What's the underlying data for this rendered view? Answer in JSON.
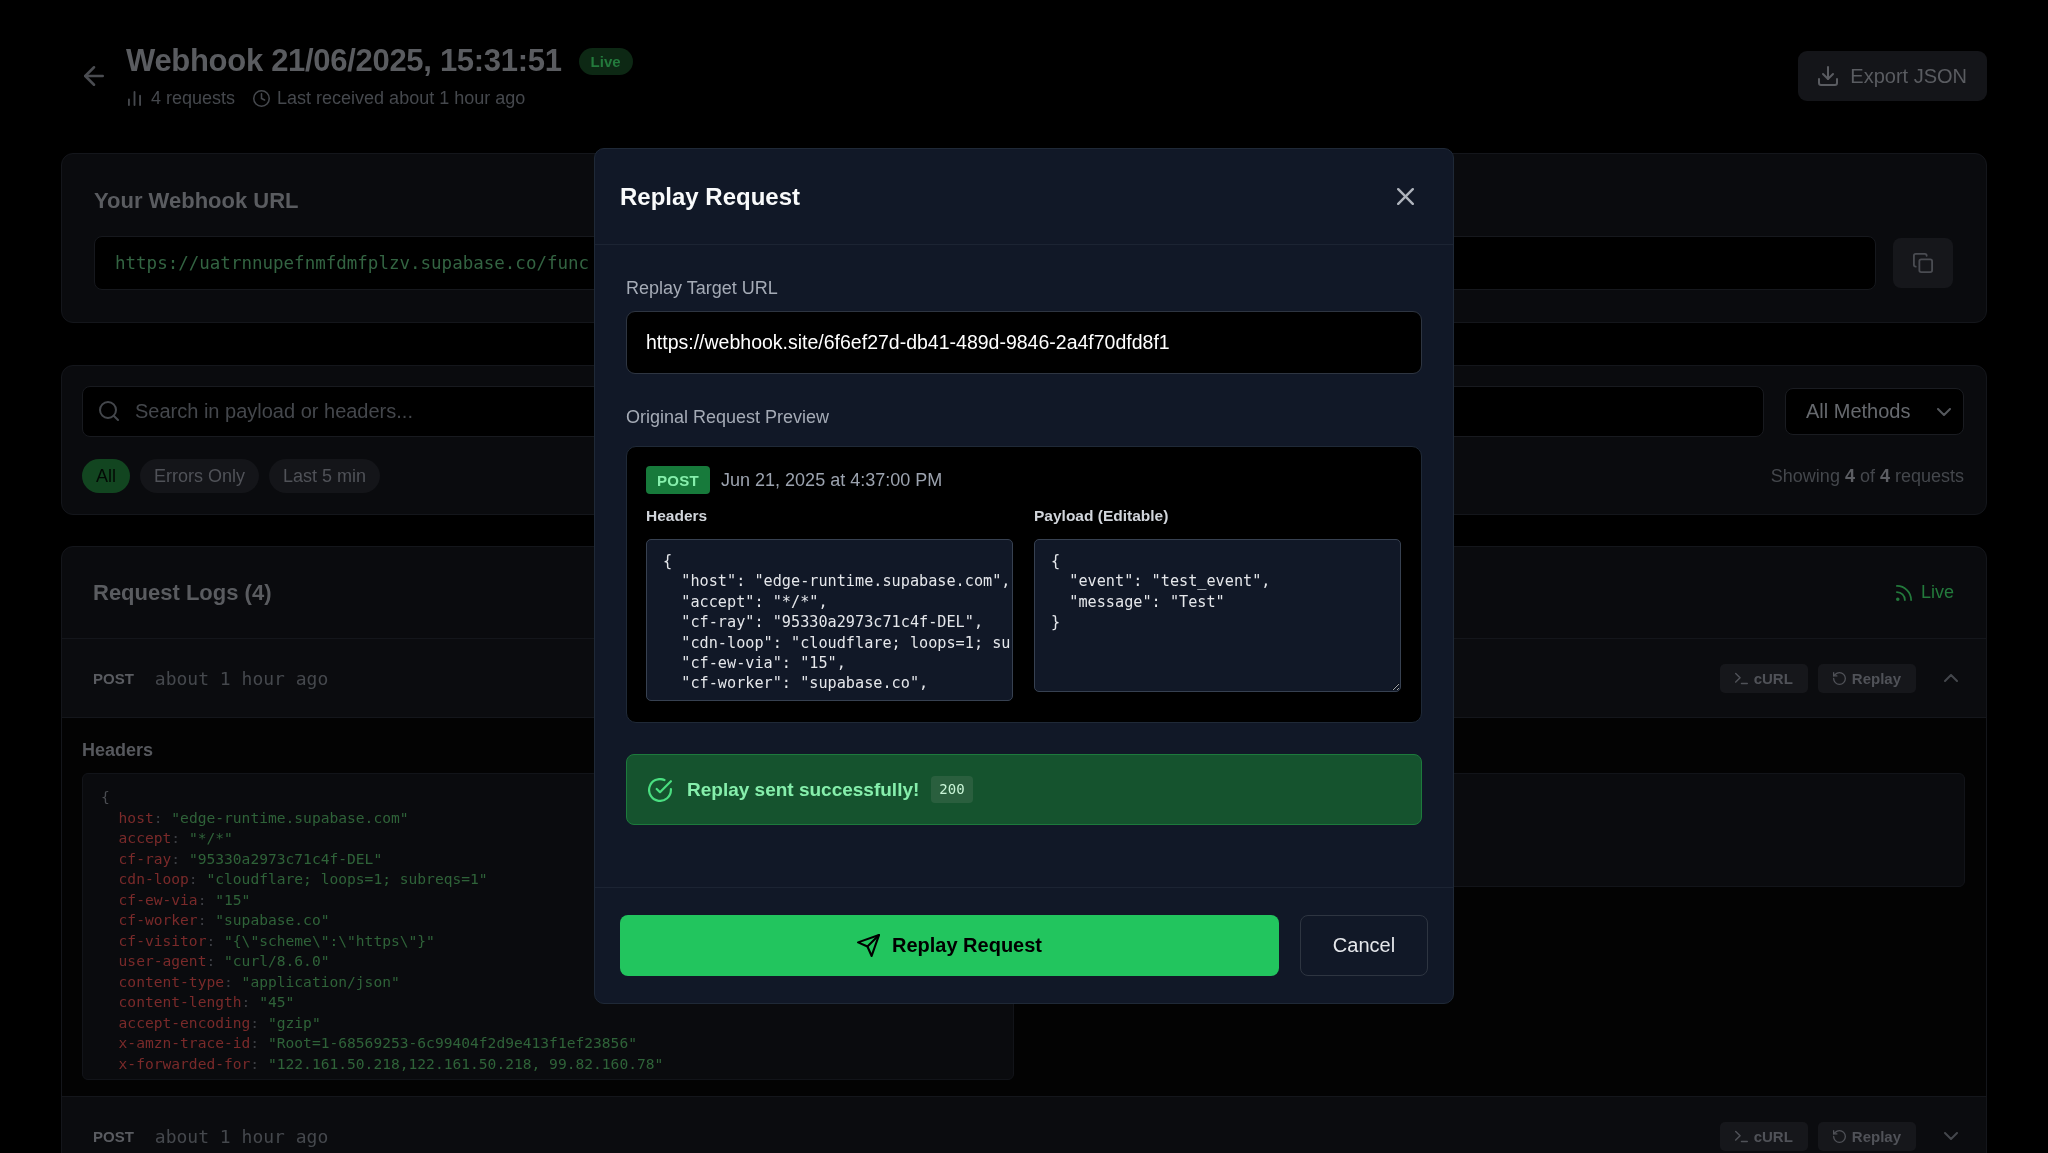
{
  "header": {
    "title": "Webhook 21/06/2025, 15:31:51",
    "live_badge": "Live",
    "request_count": "4 requests",
    "last_received": "Last received about 1 hour ago",
    "export_button": "Export JSON"
  },
  "webhook_url_card": {
    "title": "Your Webhook URL",
    "url": "https://uatrnnupefnmfdmfplzv.supabase.co/func"
  },
  "filters": {
    "search": {
      "placeholder": "Search in payload or headers..."
    },
    "method_select": {
      "value": "All Methods"
    },
    "chips": [
      {
        "label": "All",
        "selected": true
      },
      {
        "label": "Errors Only",
        "selected": false
      },
      {
        "label": "Last 5 min",
        "selected": false
      }
    ],
    "showing": "Showing **4** of **4** requests"
  },
  "request_logs": {
    "title": "Request Logs (4)",
    "live_label": "Live",
    "rows": [
      {
        "method": "POST",
        "time": "about 1 hour ago",
        "actions": [
          {
            "kind": "curl",
            "label": "cURL"
          },
          {
            "kind": "replay",
            "label": "Replay"
          }
        ],
        "expanded": true,
        "headers": {
          "label": "Headers",
          "open": "{",
          "separator": ":",
          "entries": [
            {
              "key": "host",
              "value": "\"edge-runtime.supabase.com\""
            },
            {
              "key": "accept",
              "value": "\"*/*\""
            },
            {
              "key": "cf-ray",
              "value": "\"95330a2973c71c4f-DEL\""
            },
            {
              "key": "cdn-loop",
              "value": "\"cloudflare; loops=1; subreqs=1\""
            },
            {
              "key": "cf-ew-via",
              "value": "\"15\""
            },
            {
              "key": "cf-worker",
              "value": "\"supabase.co\""
            },
            {
              "key": "cf-visitor",
              "value": "\"{\\\"scheme\\\":\\\"https\\\"}\""
            },
            {
              "key": "user-agent",
              "value": "\"curl/8.6.0\""
            },
            {
              "key": "content-type",
              "value": "\"application/json\""
            },
            {
              "key": "content-length",
              "value": "\"45\""
            },
            {
              "key": "accept-encoding",
              "value": "\"gzip\""
            },
            {
              "key": "x-amzn-trace-id",
              "value": "\"Root=1-68569253-6c99404f2d9e413f1ef23856\""
            },
            {
              "key": "x-forwarded-for",
              "value": "\"122.161.50.218,122.161.50.218, 99.82.160.78\""
            }
          ]
        }
      },
      {
        "method": "POST",
        "time": "about 1 hour ago",
        "actions": [
          {
            "kind": "curl",
            "label": "cURL"
          },
          {
            "kind": "replay",
            "label": "Replay"
          }
        ],
        "expanded": false
      }
    ]
  },
  "modal": {
    "title": "Replay Request",
    "target_url": {
      "label": "Replay Target URL",
      "value": "https://webhook.site/6f6ef27d-db41-489d-9846-2a4f70dfd8f1"
    },
    "preview": {
      "label": "Original Request Preview",
      "method": "POST",
      "timestamp": "Jun 21, 2025 at 4:37:00 PM",
      "headers_label": "Headers",
      "headers_code": "{\n  \"host\": \"edge-runtime.supabase.com\",\n  \"accept\": \"*/*\",\n  \"cf-ray\": \"95330a2973c71c4f-DEL\",\n  \"cdn-loop\": \"cloudflare; loops=1; su\n  \"cf-ew-via\": \"15\",\n  \"cf-worker\": \"supabase.co\",",
      "payload_label": "Payload (Editable)",
      "payload": "{\n  \"event\": \"test_event\",\n  \"message\": \"Test\"\n}"
    },
    "alert": {
      "kind": "success",
      "message": "Replay sent successfully!",
      "status_code": "200"
    },
    "buttons": {
      "primary": "Replay Request",
      "cancel": "Cancel"
    }
  }
}
